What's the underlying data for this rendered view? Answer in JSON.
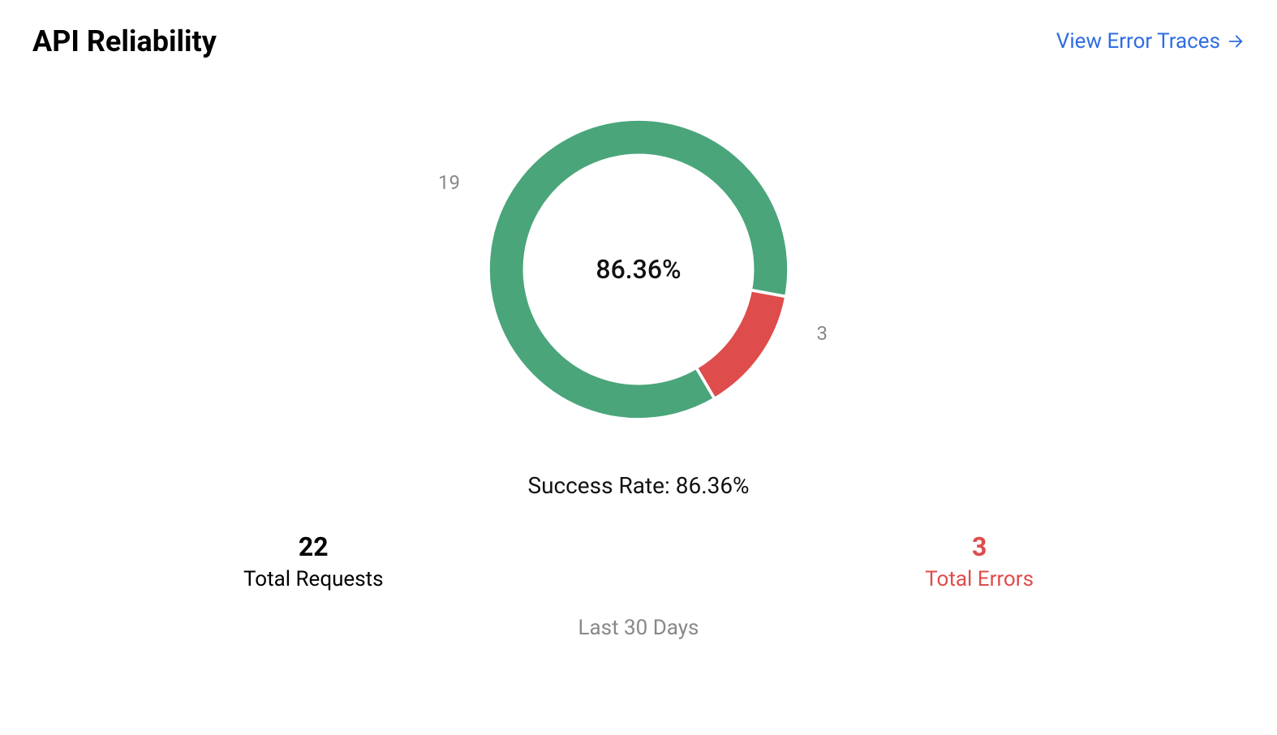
{
  "header": {
    "title": "API Reliability",
    "link_label": "View Error Traces"
  },
  "chart_data": {
    "type": "pie",
    "title": "Success Rate",
    "series": [
      {
        "name": "Success",
        "value": 19,
        "color": "#4aa57a"
      },
      {
        "name": "Error",
        "value": 3,
        "color": "#df4c4c"
      }
    ],
    "center_label": "86.36%",
    "slice_label_success": "19",
    "slice_label_error": "3"
  },
  "success_rate_line": "Success Rate: 86.36%",
  "stats": {
    "requests": {
      "value": "22",
      "label": "Total Requests"
    },
    "errors": {
      "value": "3",
      "label": "Total Errors"
    }
  },
  "footer": "Last 30 Days"
}
